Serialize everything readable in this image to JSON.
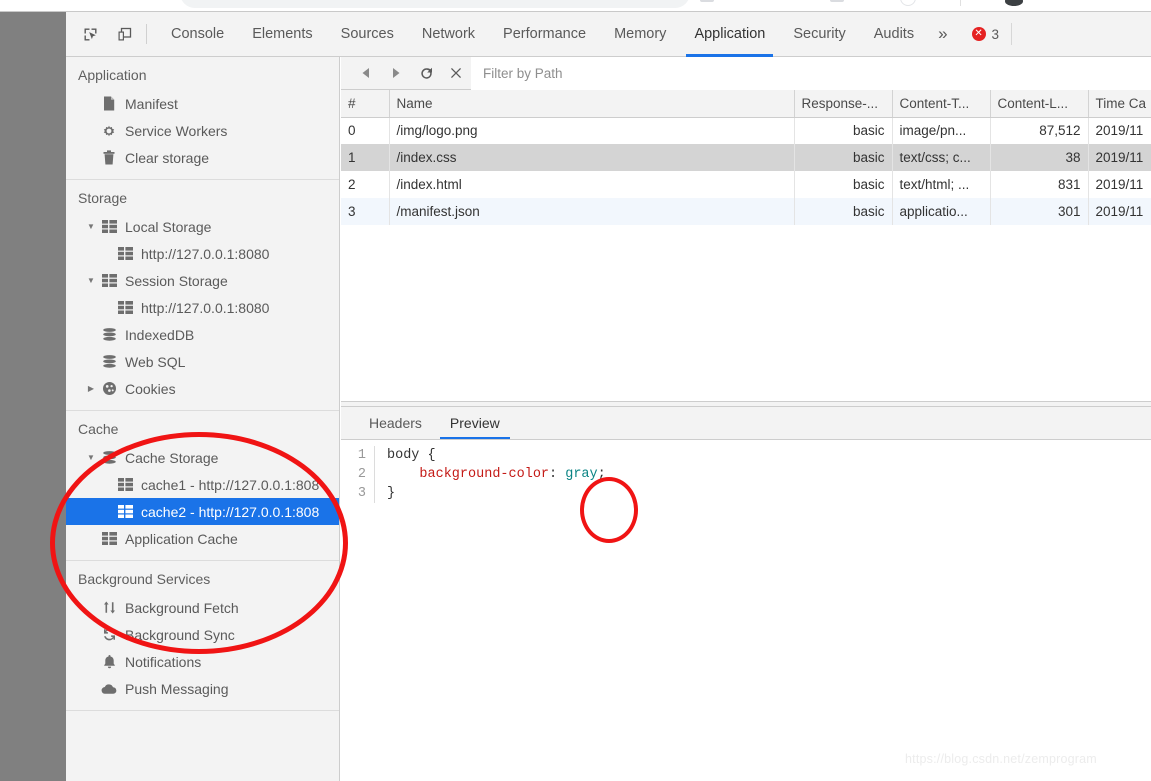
{
  "page": {
    "background_color": "#808080",
    "accent_color": "#1a73e8",
    "annotation_color": "#f01414",
    "watermark": "https://blog.csdn.net/zemprogram"
  },
  "tabbar": {
    "tools": [
      {
        "name": "inspect-element-icon",
        "label": "Inspect element"
      },
      {
        "name": "device-toolbar-icon",
        "label": "Toggle device toolbar"
      }
    ],
    "tabs": [
      {
        "label": "Console",
        "active": false
      },
      {
        "label": "Elements",
        "active": false
      },
      {
        "label": "Sources",
        "active": false
      },
      {
        "label": "Network",
        "active": false
      },
      {
        "label": "Performance",
        "active": false
      },
      {
        "label": "Memory",
        "active": false
      },
      {
        "label": "Application",
        "active": true
      },
      {
        "label": "Security",
        "active": false
      },
      {
        "label": "Audits",
        "active": false
      }
    ],
    "more_label": "»",
    "error_count": "3"
  },
  "sidebar": {
    "sections": [
      {
        "title": "Application",
        "items": [
          {
            "label": "Manifest",
            "icon": "document-icon",
            "indent": 1,
            "twisty": "",
            "selected": false
          },
          {
            "label": "Service Workers",
            "icon": "gear-icon",
            "indent": 1,
            "twisty": "",
            "selected": false
          },
          {
            "label": "Clear storage",
            "icon": "trash-icon",
            "indent": 1,
            "twisty": "",
            "selected": false
          }
        ]
      },
      {
        "title": "Storage",
        "items": [
          {
            "label": "Local Storage",
            "icon": "table-icon",
            "indent": 1,
            "twisty": "▼",
            "selected": false
          },
          {
            "label": "http://127.0.0.1:8080",
            "icon": "table-icon",
            "indent": 2,
            "twisty": "",
            "selected": false
          },
          {
            "label": "Session Storage",
            "icon": "table-icon",
            "indent": 1,
            "twisty": "▼",
            "selected": false
          },
          {
            "label": "http://127.0.0.1:8080",
            "icon": "table-icon",
            "indent": 2,
            "twisty": "",
            "selected": false
          },
          {
            "label": "IndexedDB",
            "icon": "database-icon",
            "indent": 1,
            "twisty": "",
            "selected": false
          },
          {
            "label": "Web SQL",
            "icon": "database-icon",
            "indent": 1,
            "twisty": "",
            "selected": false
          },
          {
            "label": "Cookies",
            "icon": "cookie-icon",
            "indent": 1,
            "twisty": "▶",
            "selected": false
          }
        ]
      },
      {
        "title": "Cache",
        "items": [
          {
            "label": "Cache Storage",
            "icon": "database-icon",
            "indent": 1,
            "twisty": "▼",
            "selected": false
          },
          {
            "label": "cache1 - http://127.0.0.1:808",
            "icon": "table-icon",
            "indent": 2,
            "twisty": "",
            "selected": false
          },
          {
            "label": "cache2 - http://127.0.0.1:808",
            "icon": "table-icon",
            "indent": 2,
            "twisty": "",
            "selected": true
          },
          {
            "label": "Application Cache",
            "icon": "table-icon",
            "indent": 1,
            "twisty": "",
            "selected": false
          }
        ]
      },
      {
        "title": "Background Services",
        "items": [
          {
            "label": "Background Fetch",
            "icon": "updown-arrows-icon",
            "indent": 1,
            "twisty": "",
            "selected": false
          },
          {
            "label": "Background Sync",
            "icon": "sync-icon",
            "indent": 1,
            "twisty": "",
            "selected": false
          },
          {
            "label": "Notifications",
            "icon": "bell-icon",
            "indent": 1,
            "twisty": "",
            "selected": false
          },
          {
            "label": "Push Messaging",
            "icon": "cloud-icon",
            "indent": 1,
            "twisty": "",
            "selected": false
          }
        ]
      }
    ]
  },
  "cache_toolbar": {
    "buttons": [
      {
        "name": "back-button",
        "icon": "triangle-left-icon"
      },
      {
        "name": "forward-button",
        "icon": "triangle-right-icon"
      },
      {
        "name": "refresh-button",
        "icon": "refresh-icon"
      },
      {
        "name": "delete-button",
        "icon": "close-icon"
      }
    ],
    "filter_placeholder": "Filter by Path",
    "filter_value": ""
  },
  "table": {
    "columns": [
      "#",
      "Name",
      "Response-...",
      "Content-T...",
      "Content-L...",
      "Time Ca"
    ],
    "rows": [
      {
        "index": "0",
        "name": "/img/logo.png",
        "response": "basic",
        "content_type": "image/pn...",
        "content_length": "87,512",
        "time_cached": "2019/11",
        "selected": false,
        "zebra": false
      },
      {
        "index": "1",
        "name": "/index.css",
        "response": "basic",
        "content_type": "text/css; c...",
        "content_length": "38",
        "time_cached": "2019/11",
        "selected": true,
        "zebra": false
      },
      {
        "index": "2",
        "name": "/index.html",
        "response": "basic",
        "content_type": "text/html; ...",
        "content_length": "831",
        "time_cached": "2019/11",
        "selected": false,
        "zebra": false
      },
      {
        "index": "3",
        "name": "/manifest.json",
        "response": "basic",
        "content_type": "applicatio...",
        "content_length": "301",
        "time_cached": "2019/11",
        "selected": false,
        "zebra": true
      }
    ]
  },
  "detail": {
    "tabs": [
      {
        "label": "Headers",
        "active": false
      },
      {
        "label": "Preview",
        "active": true
      }
    ],
    "code_lines": [
      {
        "number": "1",
        "plain": "body {"
      },
      {
        "number": "2",
        "prop": "    background-color",
        "colon": ": ",
        "value": "gray",
        "semi": ";"
      },
      {
        "number": "3",
        "plain": "}"
      }
    ]
  },
  "annotations": [
    {
      "name": "cache-storage-highlight",
      "shape": "ellipse"
    },
    {
      "name": "gray-value-highlight",
      "shape": "ellipse"
    }
  ]
}
